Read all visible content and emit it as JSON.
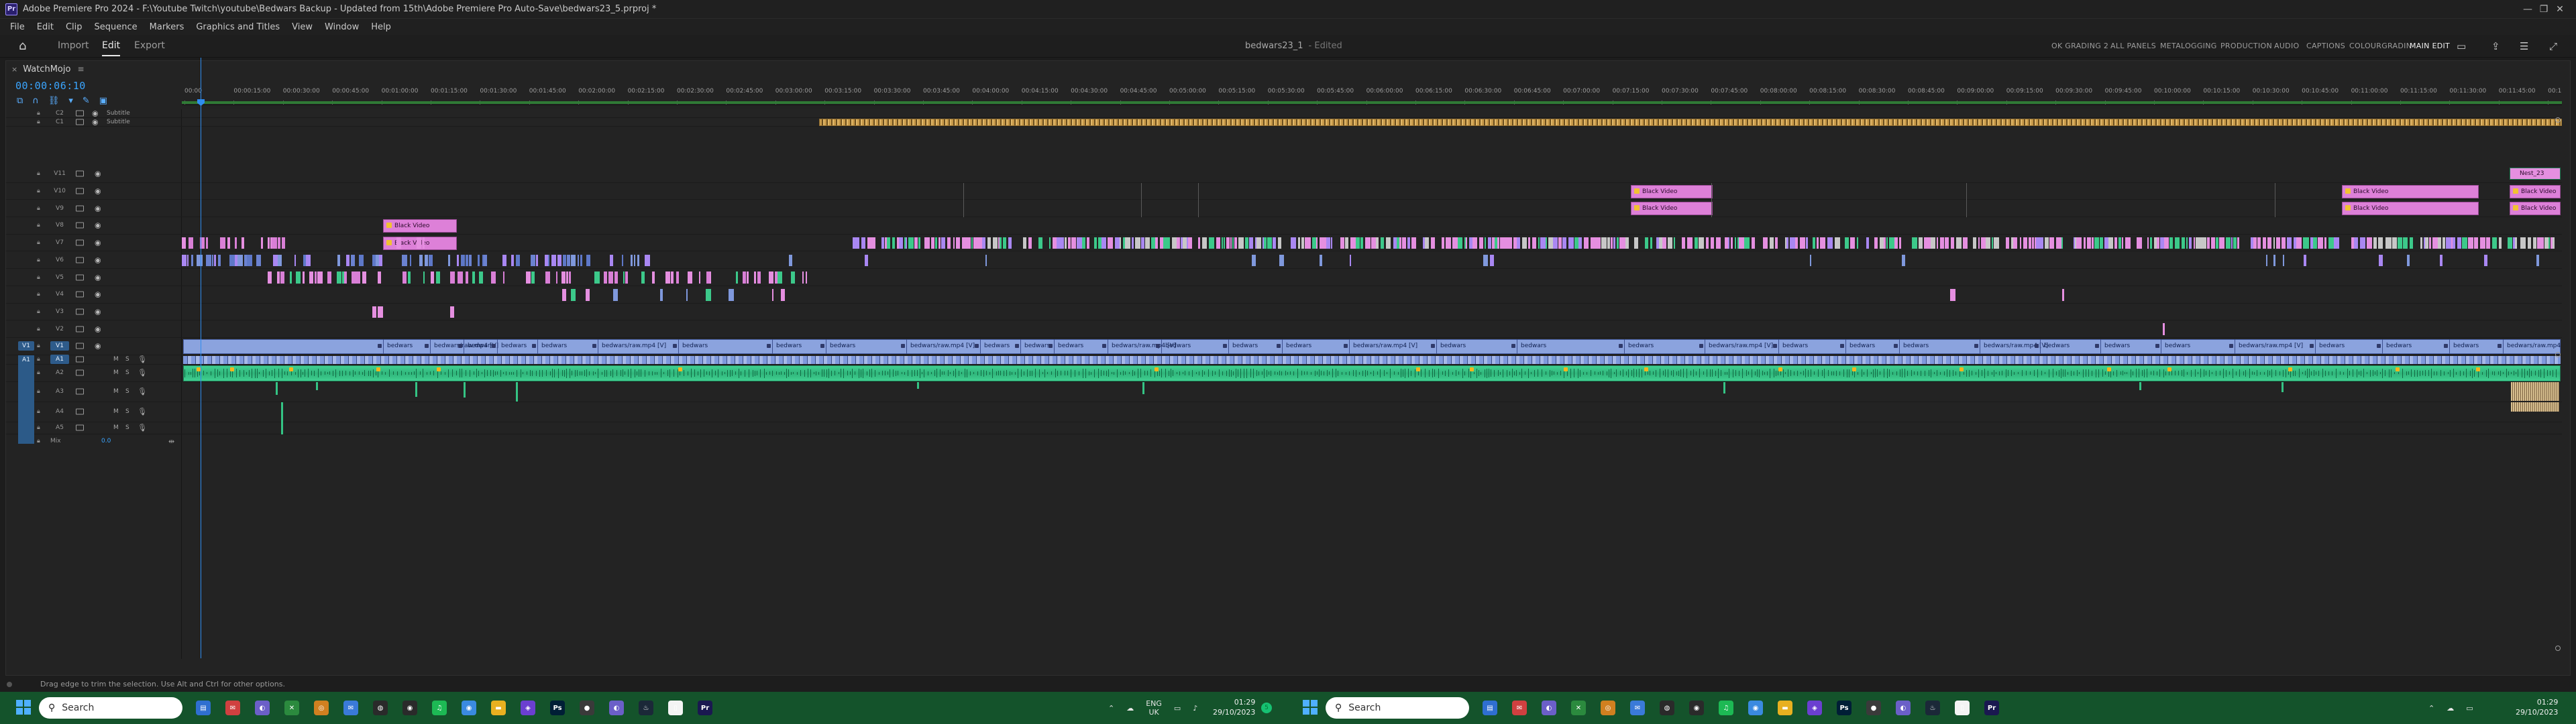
{
  "titlebar": {
    "app_icon": "Pr",
    "title": "Adobe Premiere Pro 2024 - F:\\Youtube Twitch\\youtube\\Bedwars Backup - Updated from 15th\\Adobe Premiere Pro Auto-Save\\bedwars23_5.prproj *",
    "minimize": "—",
    "maximize": "❐",
    "close": "✕"
  },
  "menu": [
    "File",
    "Edit",
    "Clip",
    "Sequence",
    "Markers",
    "Graphics and Titles",
    "View",
    "Window",
    "Help"
  ],
  "workspace": {
    "home_icon": "home-icon",
    "modes": [
      "Import",
      "Edit",
      "Export"
    ],
    "active_mode": "Edit",
    "doc_title": "bedwars23_1",
    "doc_status": "- Edited",
    "workspaces": [
      "OK GRADING 2",
      "ALL PANELS",
      "METALOGGING",
      "PRODUCTION",
      "AUDIO",
      "CAPTIONS",
      "COLOURGRADIN",
      "MAIN EDIT"
    ],
    "active_workspace": "MAIN EDIT"
  },
  "timeline": {
    "close_label": "×",
    "sequence_name": "WatchMojo",
    "menu_label": "≡",
    "timecode": "00:00:06:10",
    "ruler_ticks": [
      "00:00",
      "00:00:15:00",
      "00:00:30:00",
      "00:00:45:00",
      "00:01:00:00",
      "00:01:15:00",
      "00:01:30:00",
      "00:01:45:00",
      "00:02:00:00",
      "00:02:15:00",
      "00:02:30:00",
      "00:02:45:00",
      "00:03:00:00",
      "00:03:15:00",
      "00:03:30:00",
      "00:03:45:00",
      "00:04:00:00",
      "00:04:15:00",
      "00:04:30:00",
      "00:04:45:00",
      "00:05:00:00",
      "00:05:15:00",
      "00:05:30:00",
      "00:05:45:00",
      "00:06:00:00",
      "00:06:15:00",
      "00:06:30:00",
      "00:06:45:00",
      "00:07:00:00",
      "00:07:15:00",
      "00:07:30:00",
      "00:07:45:00",
      "00:08:00:00",
      "00:08:15:00",
      "00:08:30:00",
      "00:08:45:00",
      "00:09:00:00",
      "00:09:15:00",
      "00:09:30:00",
      "00:09:45:00",
      "00:10:00:00",
      "00:10:15:00",
      "00:10:30:00",
      "00:10:45:00",
      "00:11:00:00",
      "00:11:15:00",
      "00:11:30:00",
      "00:11:45:00",
      "00:12:00:00"
    ],
    "subtitle_tracks": [
      {
        "id": "C2",
        "name": "Subtitle"
      },
      {
        "id": "C1",
        "name": "Subtitle"
      }
    ],
    "video_tracks": [
      "V11",
      "V10",
      "V9",
      "V8",
      "V7",
      "V6",
      "V5",
      "V4",
      "V3",
      "V2",
      "V1"
    ],
    "source_video": "V1",
    "audio_tracks": [
      "A1",
      "A2",
      "A3",
      "A4",
      "A5"
    ],
    "source_audio": "A1",
    "audio_buttons": {
      "mute": "M",
      "solo": "S"
    },
    "mix_label": "Mix",
    "mix_value": "0.0",
    "black_video_label": "Black Video",
    "nest_label": "Nest_23",
    "v1_clip_label": "bedwars",
    "v1_clip_label_long": "bedwars/raw.mp4 [V]"
  },
  "status_bar": {
    "hint": "Drag edge to trim the selection. Use Alt and Ctrl for other options."
  },
  "taskbar": {
    "search_placeholder": "Search",
    "lang": "ENG",
    "region": "UK",
    "time": "01:29",
    "date": "29/10/2023",
    "notif_count": "5"
  },
  "colors": {
    "video_clip_pink": "#e58fe0",
    "video_clip_blue": "#7f98dc",
    "audio_clip": "#3cc98a",
    "playhead": "#2f8df0",
    "taskbar": "#14532b"
  }
}
